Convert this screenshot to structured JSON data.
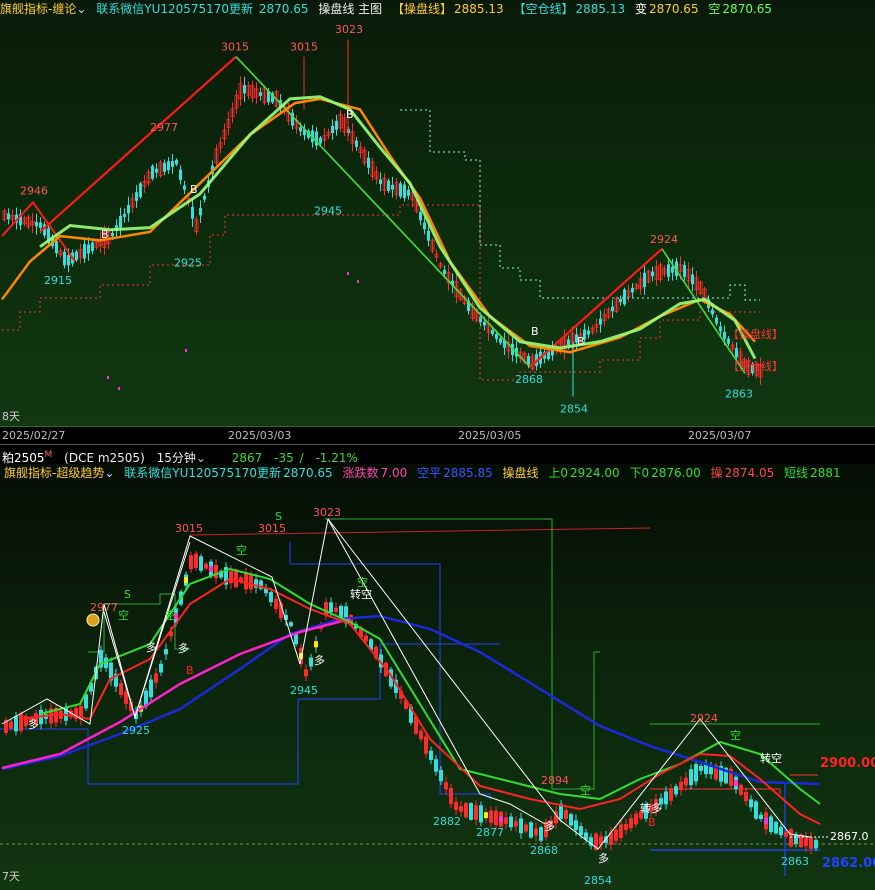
{
  "top": {
    "header": {
      "indicator": "旗舰指标-缠论",
      "contact": "联系微信YU120575170更新",
      "price": "2870.65",
      "mode": "操盘线 主图",
      "op_label": "【操盘线】",
      "op_value": "2885.13",
      "empty_label": "【空仓线】",
      "empty_value": "2885.13",
      "change_label": "变",
      "change_value": "2870.65",
      "short_label": "空",
      "short_value": "2870.65"
    },
    "corner_label": "8天",
    "dates": [
      "2025/02/27",
      "2025/03/03",
      "2025/03/05",
      "2025/03/07"
    ],
    "right_labels": [
      "【操盘线】",
      "【空仓线】"
    ],
    "colors": {
      "up": "#ff2a2a",
      "down": "#33e0e0",
      "ma_fast": "#ff9a00",
      "ma_slow": "#aaff66",
      "zig_up": "#ff1a1a",
      "zig_down": "#44dd44"
    }
  },
  "symbol_bar": {
    "symbol": "粕2505",
    "exchange": "(DCE m2505)",
    "period": "15分钟",
    "last": "2867",
    "change": "-35",
    "pct": "-1.21%"
  },
  "bottom": {
    "header": {
      "indicator": "旗舰指标-超级趋势",
      "contact": "联系微信YU120575170更新",
      "price": "2870.65",
      "chg_label": "涨跌数",
      "chg_value": "7.00",
      "kp_label": "空平",
      "kp_value": "2885.85",
      "op_label": "操盘线",
      "up_label": "上0",
      "up_value": "2924.00",
      "dn_label": "下0",
      "dn_value": "2876.00",
      "cao_label": "操",
      "cao_value": "2874.05",
      "short_label": "短线",
      "short_value": "2881"
    },
    "corner_label": "7天",
    "price_labels": [
      "2900.00",
      "2867.0",
      "2862.00"
    ],
    "signals": [
      "多",
      "空",
      "转空",
      "转多",
      "S",
      "B"
    ],
    "colors": {
      "up": "#ff2a2a",
      "down": "#33e0e0",
      "ma_blue": "#1a2ad8",
      "ma_magenta": "#ff22cc",
      "ma_green": "#33dd33",
      "ma_red": "#ff2222"
    }
  },
  "chart_data": [
    {
      "type": "line",
      "title": "",
      "x": [
        "2025/02/27",
        "2025/03/03",
        "2025/03/05",
        "2025/03/07"
      ],
      "series": [
        {
          "name": "操盘线",
          "values": [
            2935,
            2962,
            2988,
            2928,
            2890,
            2898,
            2905,
            2885
          ]
        }
      ],
      "annotations": [
        {
          "label": "2946",
          "value": 2946
        },
        {
          "label": "2915",
          "value": 2915
        },
        {
          "label": "2925",
          "value": 2925
        },
        {
          "label": "2977",
          "value": 2977
        },
        {
          "label": "3015",
          "value": 3015
        },
        {
          "label": "3015",
          "value": 3015
        },
        {
          "label": "3023",
          "value": 3023
        },
        {
          "label": "2945",
          "value": 2945
        },
        {
          "label": "2868",
          "value": 2868
        },
        {
          "label": "2854",
          "value": 2854
        },
        {
          "label": "2924",
          "value": 2924
        },
        {
          "label": "2863",
          "value": 2863
        }
      ],
      "ylim": [
        2850,
        3030
      ]
    },
    {
      "type": "line",
      "title": "",
      "series": [
        {
          "name": "超级趋势",
          "values": [
            2925,
            2960,
            3005,
            2990,
            2920,
            2880,
            2865,
            2905,
            2867
          ]
        }
      ],
      "annotations": [
        {
          "label": "2925",
          "value": 2925
        },
        {
          "label": "2977",
          "value": 2977
        },
        {
          "label": "3015",
          "value": 3015
        },
        {
          "label": "3015",
          "value": 3015
        },
        {
          "label": "3023",
          "value": 3023
        },
        {
          "label": "2945",
          "value": 2945
        },
        {
          "label": "2882",
          "value": 2882
        },
        {
          "label": "2877",
          "value": 2877
        },
        {
          "label": "2868",
          "value": 2868
        },
        {
          "label": "2894",
          "value": 2894
        },
        {
          "label": "2854",
          "value": 2854
        },
        {
          "label": "2924",
          "value": 2924
        },
        {
          "label": "2863",
          "value": 2863
        }
      ],
      "ylim": [
        2850,
        3030
      ]
    }
  ]
}
